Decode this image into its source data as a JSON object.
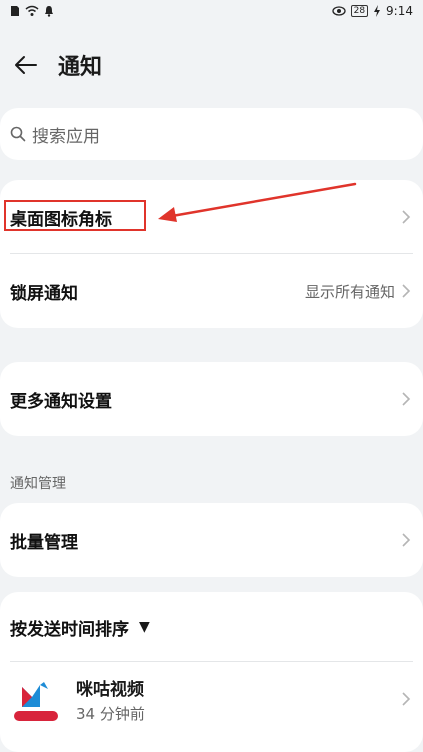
{
  "status_bar": {
    "battery": "28",
    "time": "9:14"
  },
  "header": {
    "title": "通知"
  },
  "search": {
    "placeholder": "搜索应用"
  },
  "settings_card_1": {
    "items": [
      {
        "label": "桌面图标角标"
      },
      {
        "label": "锁屏通知",
        "value": "显示所有通知"
      }
    ]
  },
  "settings_card_2": {
    "items": [
      {
        "label": "更多通知设置"
      }
    ]
  },
  "group": {
    "header": "通知管理",
    "batch_label": "批量管理"
  },
  "sort": {
    "label": "按发送时间排序"
  },
  "apps": [
    {
      "name": "咪咕视频",
      "time": "34 分钟前",
      "icon_caption": "咪咕视频"
    }
  ],
  "annotation": {
    "highlight_color": "#e0342b"
  }
}
